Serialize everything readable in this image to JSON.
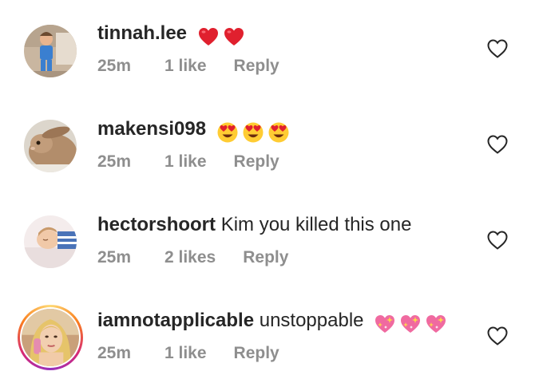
{
  "comments": [
    {
      "username": "tinnah.lee",
      "text": "",
      "emojis": [
        "red-heart",
        "red-heart"
      ],
      "time": "25m",
      "likes": "1 like",
      "reply": "Reply",
      "has_story_ring": false
    },
    {
      "username": "makensi098",
      "text": "",
      "emojis": [
        "heart-eyes",
        "heart-eyes",
        "heart-eyes"
      ],
      "time": "25m",
      "likes": "1 like",
      "reply": "Reply",
      "has_story_ring": false
    },
    {
      "username": "hectorshoort",
      "text": "Kim you killed this one",
      "emojis": [],
      "time": "25m",
      "likes": "2 likes",
      "reply": "Reply",
      "has_story_ring": false
    },
    {
      "username": "iamnotapplicable",
      "text": "unstoppable",
      "emojis": [
        "sparkling-heart",
        "sparkling-heart",
        "sparkling-heart"
      ],
      "time": "25m",
      "likes": "1 like",
      "reply": "Reply",
      "has_story_ring": true
    }
  ],
  "colors": {
    "text_primary": "#262626",
    "text_secondary": "#8e8e8e",
    "like_icon": "#262626",
    "story_ring": [
      "#feda75",
      "#fa7e1e",
      "#d62976",
      "#962fbf"
    ]
  },
  "icons": {
    "like": "heart-outline-icon"
  }
}
